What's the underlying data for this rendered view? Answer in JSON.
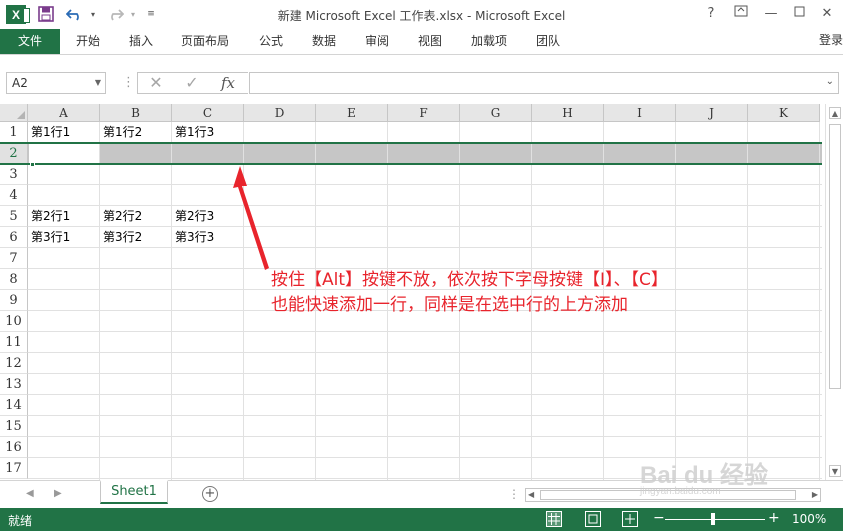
{
  "window": {
    "title": "新建 Microsoft Excel 工作表.xlsx - Microsoft Excel",
    "logo_letter": "X",
    "help": "?",
    "minimize": "—",
    "restore": "▫",
    "close": "✕"
  },
  "ribbon": {
    "tabs": [
      "文件",
      "开始",
      "插入",
      "页面布局",
      "公式",
      "数据",
      "审阅",
      "视图",
      "加载项",
      "团队"
    ],
    "login": "登录"
  },
  "formula_bar": {
    "name_box": "A2",
    "cancel": "✕",
    "enter": "✓",
    "fx": "fx",
    "value": ""
  },
  "grid": {
    "columns": [
      "A",
      "B",
      "C",
      "D",
      "E",
      "F",
      "G",
      "H",
      "I",
      "J",
      "K"
    ],
    "rows": [
      "1",
      "2",
      "3",
      "4",
      "5",
      "6",
      "7",
      "8",
      "9",
      "10",
      "11",
      "12",
      "13",
      "14",
      "15",
      "16",
      "17"
    ],
    "selected_row": "2",
    "cells": {
      "A1": "第1行1",
      "B1": "第1行2",
      "C1": "第1行3",
      "A5": "第2行1",
      "B5": "第2行2",
      "C5": "第2行3",
      "A6": "第3行1",
      "B6": "第3行2",
      "C6": "第3行3"
    }
  },
  "annotation": {
    "line1": "按住【Alt】按键不放，依次按下字母按键【I】、【C】",
    "line2": "也能快速添加一行，同样是在选中行的上方添加",
    "color": "#e8242c"
  },
  "sheets": {
    "tabs": [
      "Sheet1"
    ],
    "add": "+"
  },
  "status": {
    "text": "就绪",
    "zoom": "100%",
    "zoom_level": 100,
    "accent": "#217346"
  },
  "watermark": {
    "brand": "Bai du 经验",
    "url": "jingyan.baidu.com"
  }
}
